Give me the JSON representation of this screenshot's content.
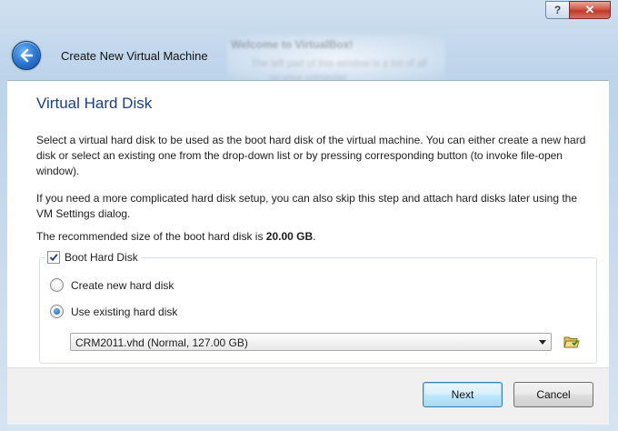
{
  "window": {
    "help_glyph": "?",
    "close_glyph": "✕",
    "background_text": "Welcome to VirtualBox!"
  },
  "header": {
    "title": "Create New Virtual Machine"
  },
  "page": {
    "title": "Virtual Hard Disk",
    "paragraph1": "Select a virtual hard disk to be used as the boot hard disk of the virtual machine. You can either create a new hard disk or select an existing one from the drop-down list or by pressing corresponding button (to invoke file-open window).",
    "paragraph2": "If you need a more complicated hard disk setup, you can also skip this step and attach hard disks later using the VM Settings dialog.",
    "recommended_prefix": "The recommended size of the boot hard disk is ",
    "recommended_size": "20.00 GB",
    "recommended_suffix": "."
  },
  "boot_disk": {
    "label": "Boot Hard Disk",
    "checked": true,
    "options": [
      {
        "label": "Create new hard disk",
        "selected": false
      },
      {
        "label": "Use existing hard disk",
        "selected": true
      }
    ],
    "selected_disk": "CRM2011.vhd (Normal, 127.00 GB)",
    "folder_icon": "folder-open-icon"
  },
  "buttons": {
    "next": "Next",
    "cancel": "Cancel"
  },
  "colors": {
    "title_blue": "#1c3f86",
    "back_button_blue": "#2a78d2",
    "close_red": "#c03a2b"
  }
}
